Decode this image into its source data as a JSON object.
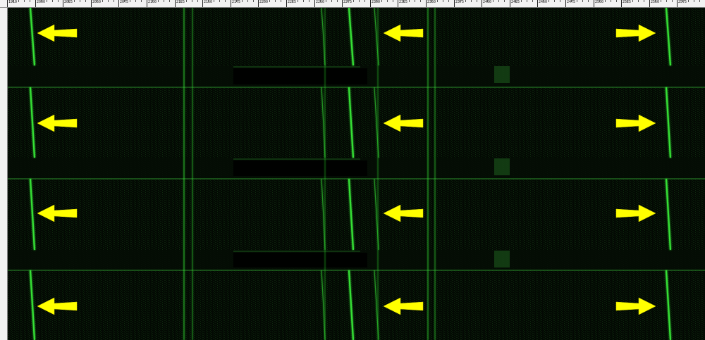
{
  "app": {
    "title": ""
  },
  "ruler": {
    "labels": [
      "1910",
      "2000",
      "2025",
      "2050",
      "2075",
      "2100",
      "2125",
      "2150",
      "2175",
      "2200",
      "2225",
      "2250",
      "2275",
      "2300",
      "2325",
      "2350",
      "2375",
      "2400",
      "2425",
      "2450",
      "2475",
      "2500",
      "2525",
      "2550",
      "2575"
    ],
    "units": "Hz"
  },
  "waterfall": {
    "background": "#030903",
    "signal_color": "#35e035",
    "arrow_color": "#ffff00",
    "time_labels": [
      "",
      "",
      "",
      "",
      "",
      "",
      "",
      "",
      "",
      "",
      "",
      "",
      "",
      "",
      "",
      ""
    ]
  }
}
